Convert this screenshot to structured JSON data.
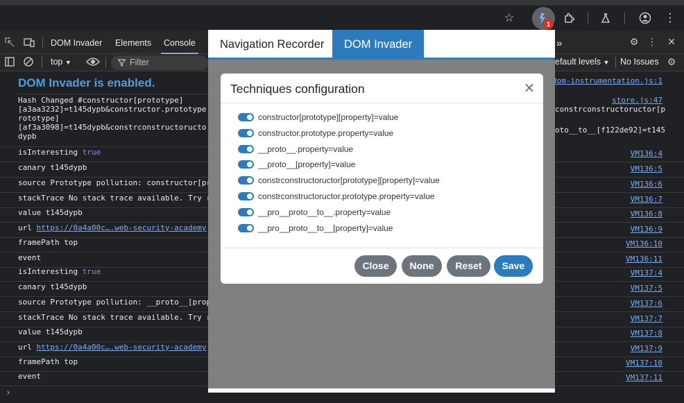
{
  "browser": {
    "extension_badge": "1",
    "icons": [
      "star-icon",
      "dom-invader-extension-icon",
      "puzzle-icon",
      "flask-icon",
      "profile-icon",
      "kebab-menu-icon"
    ]
  },
  "devtools": {
    "tabs": [
      {
        "label": "DOM Invader"
      },
      {
        "label": "Elements"
      },
      {
        "label": "Console"
      }
    ],
    "right_tab_fragment": "»",
    "console_toolbar": {
      "context": "top",
      "filter_placeholder": "Filter",
      "levels": "efault levels",
      "issues": "No Issues"
    }
  },
  "console": {
    "banner": "DOM Invader is enabled.",
    "banner_source": "dom-instrumentation.js:1",
    "hash_block": {
      "lines": [
        "Hash Changed #constructor[prototype]",
        "[a3aa3232]=t145dypb&constructor.prototype",
        "rototype]",
        "[af3a3098]=t145dypb&constrconstructoructo",
        "dypb"
      ],
      "source": "store.js:47",
      "right_lines": [
        "constrconstructoructor[p",
        "oto__to__[f122de92]=t145"
      ]
    },
    "rows": [
      {
        "text": "isInteresting ",
        "kw": "true",
        "src": "VM136:4"
      },
      {
        "text": "canary t145dypb",
        "src": "VM136:5"
      },
      {
        "text": "source Prototype pollution: constructor[pr",
        "src": "VM136:6"
      },
      {
        "text": "stackTrace No stack trace available. Try r",
        "src": "VM136:7"
      },
      {
        "text": "value t145dypb",
        "src": "VM136:8"
      },
      {
        "text": "url ",
        "url": "https://0a4a00c….web-security-academy",
        "src": "VM136:9"
      },
      {
        "text": "framePath top",
        "src": "VM136:10"
      },
      {
        "text": "event",
        "src": "VM136:11"
      },
      {
        "text": "isInteresting ",
        "kw": "true",
        "src": "VM137:4"
      },
      {
        "text": "canary t145dypb",
        "src": "VM137:5"
      },
      {
        "text": "source Prototype pollution: __proto__[prop",
        "src": "VM137:6"
      },
      {
        "text": "stackTrace No stack trace available. Try r",
        "src": "VM137:7"
      },
      {
        "text": "value t145dypb",
        "src": "VM137:8"
      },
      {
        "text": "url ",
        "url": "https://0a4a00c….web-security-academy",
        "src": "VM137:9"
      },
      {
        "text": "framePath top",
        "src": "VM137:10"
      },
      {
        "text": "event",
        "src": "VM137:11"
      }
    ],
    "prompt": "›"
  },
  "popup": {
    "tabs": [
      {
        "label": "Navigation Recorder",
        "active": false
      },
      {
        "label": "DOM Invader",
        "active": true
      }
    ],
    "modal": {
      "title": "Techniques configuration",
      "close": "×",
      "options": [
        "constructor[prototype][property]=value",
        "constructor.prototype.property=value",
        "__proto__.property=value",
        "__proto__[property]=value",
        "constrconstructoructor[prototype][property]=value",
        "constrconstructoructor.prototype.property=value",
        "__pro__proto__to__.property=value",
        "__pro__proto__to__[property]=value"
      ],
      "buttons": {
        "close": "Close",
        "none": "None",
        "reset": "Reset",
        "save": "Save"
      }
    }
  },
  "colors": {
    "accent": "#2b7bbd",
    "link": "#7cacf8",
    "keyword": "#9980ff"
  }
}
